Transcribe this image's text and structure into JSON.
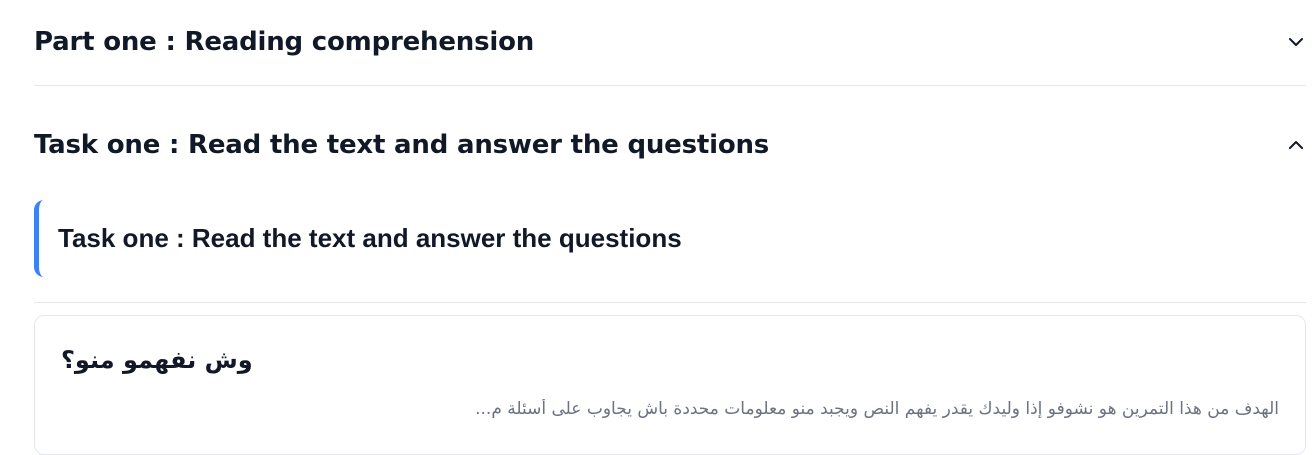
{
  "part_one": {
    "title": "Part one : Reading comprehension",
    "expanded": false,
    "icon": "chevron-down-icon"
  },
  "task_one": {
    "title": "Task one : Read the text and answer the questions",
    "expanded": true,
    "icon": "chevron-up-icon",
    "callout_text": "Task one : Read the text and answer the questions",
    "accent_color": "#3b82f6"
  },
  "info_card": {
    "title": "وش نفهمو منو؟",
    "description": "الهدف من هذا التمرين هو نشوفو إذا وليدك يقدر يفهم النص ويجبد منو معلومات محددة باش يجاوب على أسئلة م..."
  }
}
